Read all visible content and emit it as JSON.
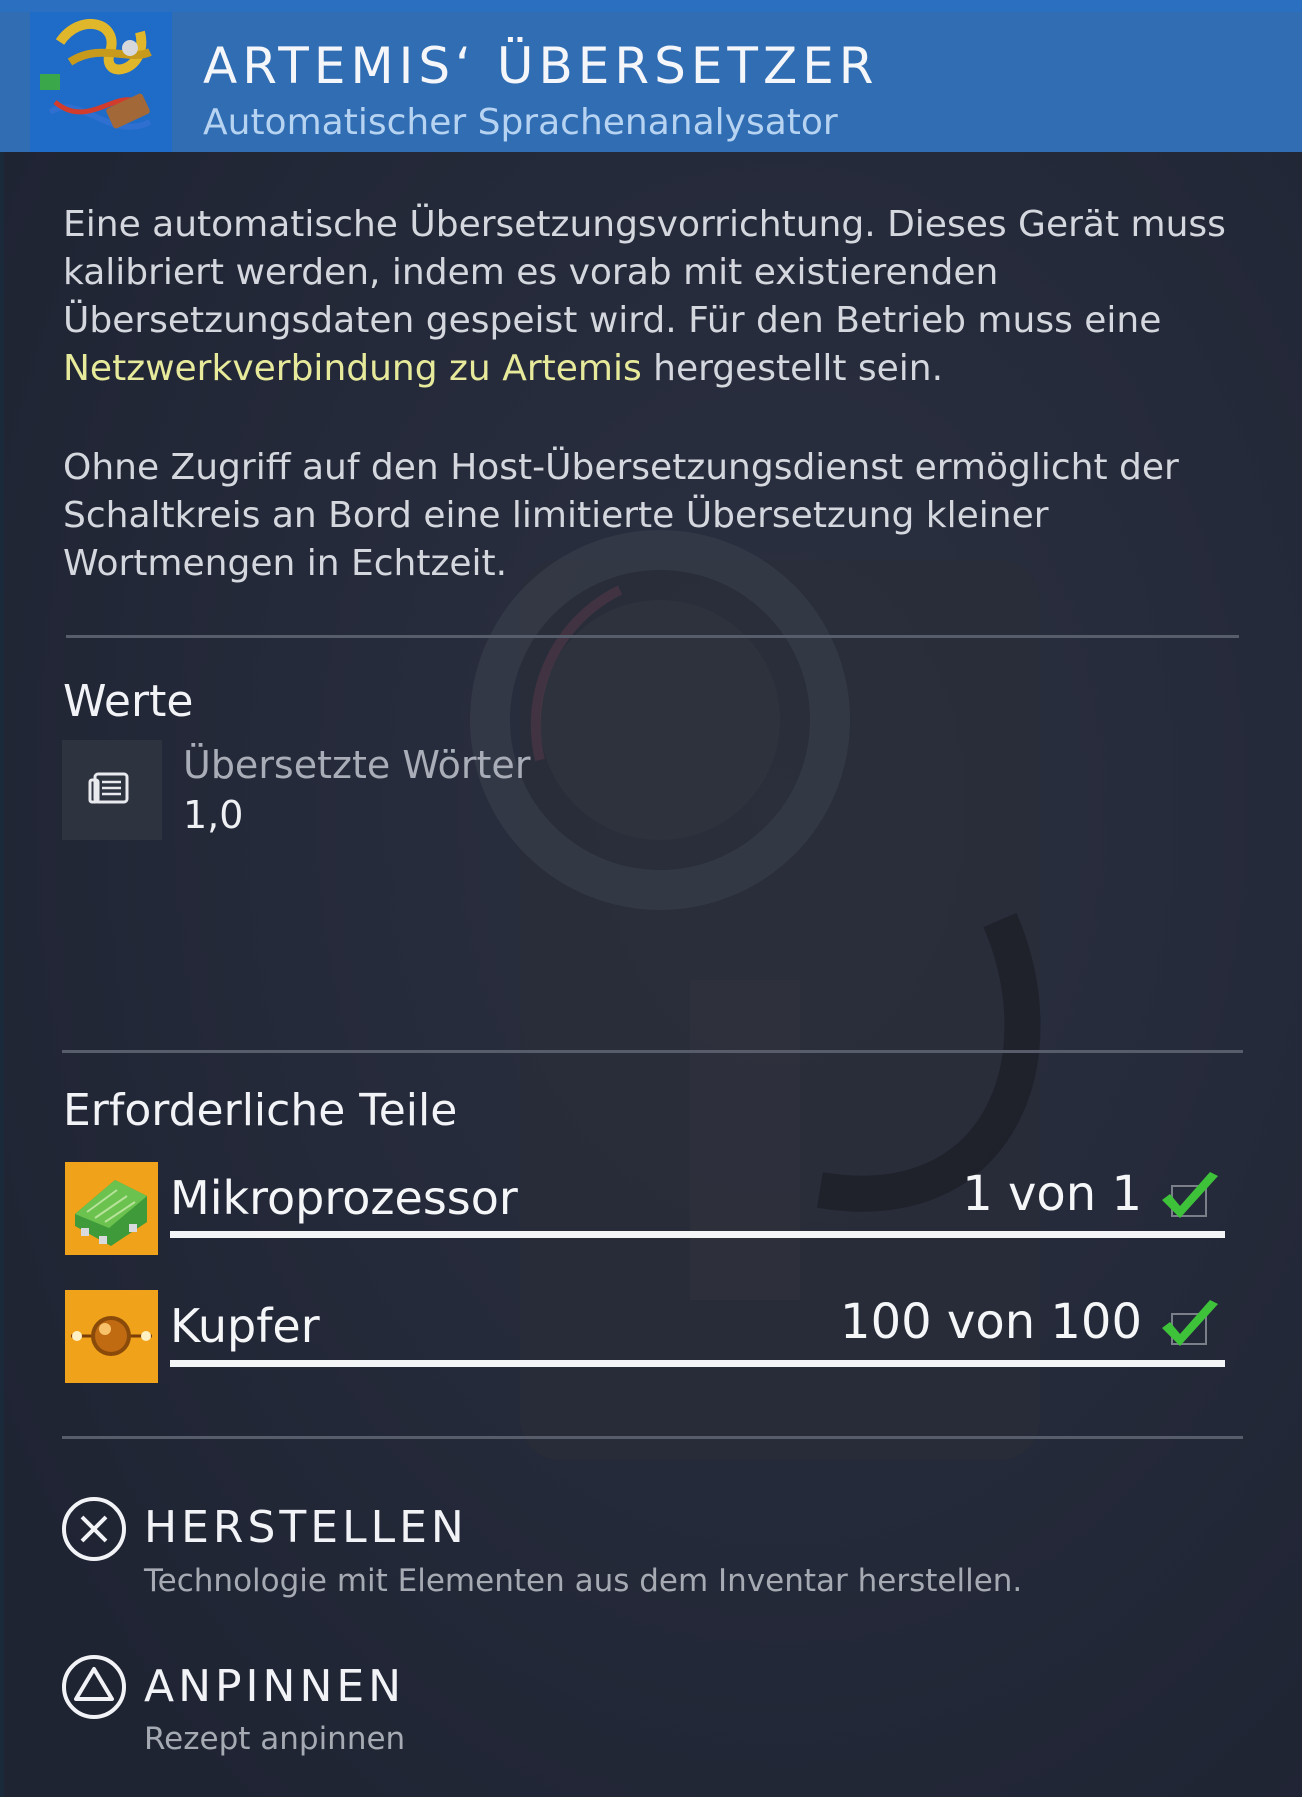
{
  "header": {
    "title": "ARTEMIS‘ ÜBERSETZER",
    "subtitle": "Automatischer Sprachenanalysator",
    "icon": "translator-device-icon"
  },
  "description": {
    "p1_before": "Eine automatische Übersetzungsvorrichtung. Dieses Gerät muss kalibriert werden, indem es vorab mit existierenden Übersetzungsdaten gespeist wird. Für den Betrieb muss eine ",
    "p1_highlight": "Netzwerkverbindung zu Artemis",
    "p1_after": " hergestellt sein.",
    "p2": "Ohne Zugriff auf den Host-Übersetzungsdienst ermöglicht der Schaltkreis an Bord eine limitierte Übersetzung kleiner Wortmengen in Echtzeit."
  },
  "stats": {
    "title": "Werte",
    "items": [
      {
        "label": "Übersetzte Wörter",
        "value": "1,0",
        "icon": "document-icon"
      }
    ]
  },
  "parts": {
    "title": "Erforderliche Teile",
    "items": [
      {
        "name": "Mikroprozessor",
        "count": "1 von 1",
        "have": 1,
        "need": 1,
        "icon": "microprocessor-icon",
        "complete": true
      },
      {
        "name": "Kupfer",
        "count": "100 von 100",
        "have": 100,
        "need": 100,
        "icon": "copper-icon",
        "complete": true
      }
    ]
  },
  "actions": [
    {
      "label": "HERSTELLEN",
      "description": "Technologie mit Elementen aus dem Inventar herstellen.",
      "icon": "cross-button-icon"
    },
    {
      "label": "ANPINNEN",
      "description": "Rezept anpinnen",
      "icon": "triangle-button-icon"
    }
  ],
  "colors": {
    "header_bg": "#306db3",
    "panel_bg": "#232838",
    "highlight": "#e7ea9a",
    "item_icon_bg": "#f0a21a",
    "check": "#3ec23a"
  }
}
